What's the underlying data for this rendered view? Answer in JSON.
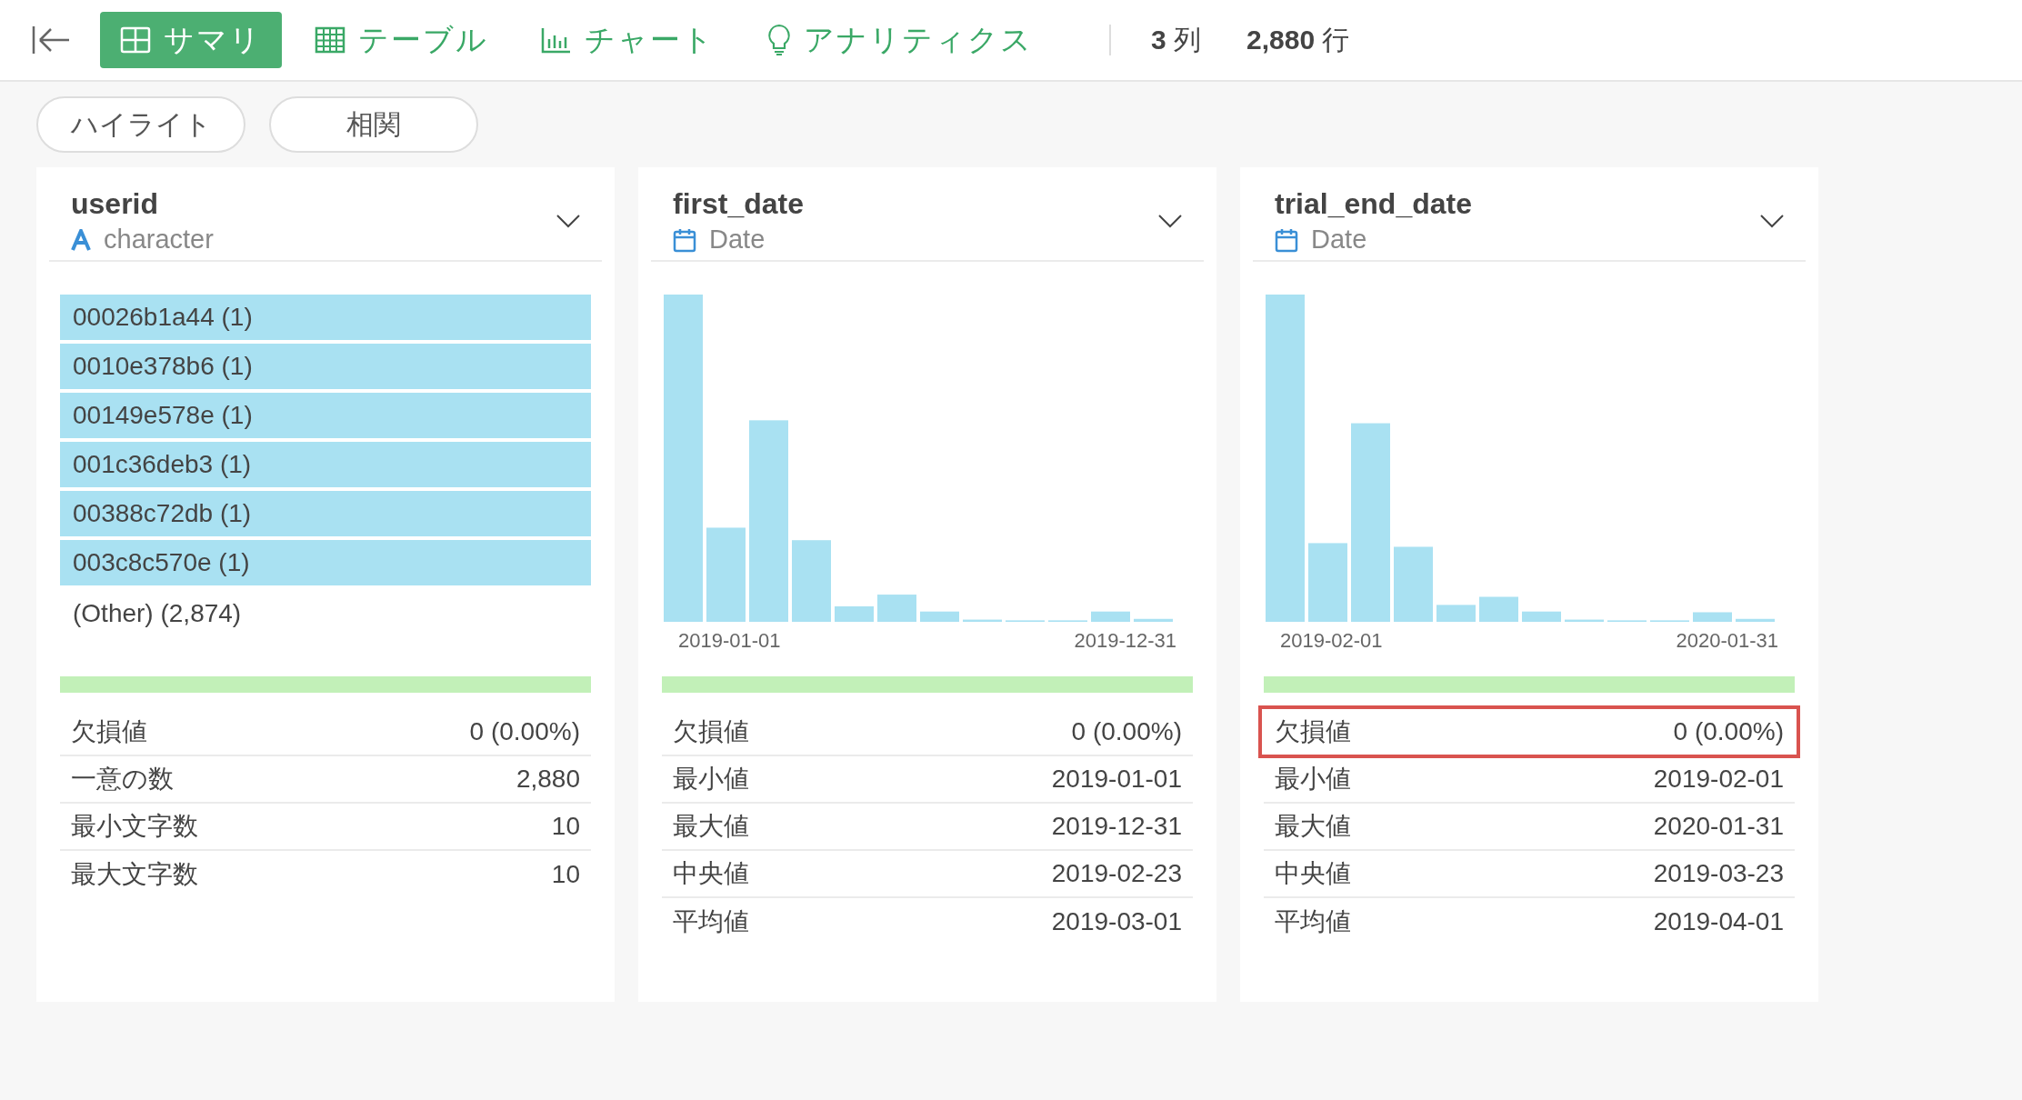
{
  "toolbar": {
    "tabs": [
      {
        "label": "サマリ",
        "kind": "grid",
        "selected": true
      },
      {
        "label": "テーブル",
        "kind": "table",
        "selected": false
      },
      {
        "label": "チャート",
        "kind": "chart",
        "selected": false
      },
      {
        "label": "アナリティクス",
        "kind": "bulb",
        "selected": false
      }
    ],
    "columns_count": "3",
    "columns_unit": "列",
    "rows_count": "2,880",
    "rows_unit": "行"
  },
  "filters": [
    "ハイライト",
    "相関"
  ],
  "cards": [
    {
      "name": "userid",
      "kind": "character",
      "type_label": "character",
      "top_values": [
        "00026b1a44 (1)",
        "0010e378b6 (1)",
        "00149e578e (1)",
        "001c36deb3 (1)",
        "00388c72db (1)",
        "003c8c570e (1)"
      ],
      "other": "(Other) (2,874)",
      "completeness": {
        "level": 1
      },
      "stats": [
        {
          "label": "欠損値",
          "value": "0 (0.00%)",
          "highlighted": false
        },
        {
          "label": "一意の数",
          "value": "2,880",
          "highlighted": false
        },
        {
          "label": "最小文字数",
          "value": "10",
          "highlighted": false
        },
        {
          "label": "最大文字数",
          "value": "10",
          "highlighted": false
        }
      ]
    },
    {
      "name": "first_date",
      "kind": "date",
      "type_label": "Date",
      "histogram": {
        "start_label": "2019-01-01",
        "end_label": "2019-12-31"
      },
      "completeness": {
        "level": 1
      },
      "stats": [
        {
          "label": "欠損値",
          "value": "0 (0.00%)",
          "highlighted": false
        },
        {
          "label": "最小値",
          "value": "2019-01-01",
          "highlighted": false
        },
        {
          "label": "最大値",
          "value": "2019-12-31",
          "highlighted": false
        },
        {
          "label": "中央値",
          "value": "2019-02-23",
          "highlighted": false
        },
        {
          "label": "平均値",
          "value": "2019-03-01",
          "highlighted": false
        }
      ]
    },
    {
      "name": "trial_end_date",
      "kind": "date",
      "type_label": "Date",
      "histogram": {
        "start_label": "2019-02-01",
        "end_label": "2020-01-31"
      },
      "completeness": {
        "level": 1
      },
      "stats": [
        {
          "label": "欠損値",
          "value": "0 (0.00%)",
          "highlighted": true
        },
        {
          "label": "最小値",
          "value": "2019-02-01",
          "highlighted": false
        },
        {
          "label": "最大値",
          "value": "2020-01-31",
          "highlighted": false
        },
        {
          "label": "中央値",
          "value": "2019-03-23",
          "highlighted": false
        },
        {
          "label": "平均値",
          "value": "2019-04-01",
          "highlighted": false
        }
      ]
    }
  ]
}
